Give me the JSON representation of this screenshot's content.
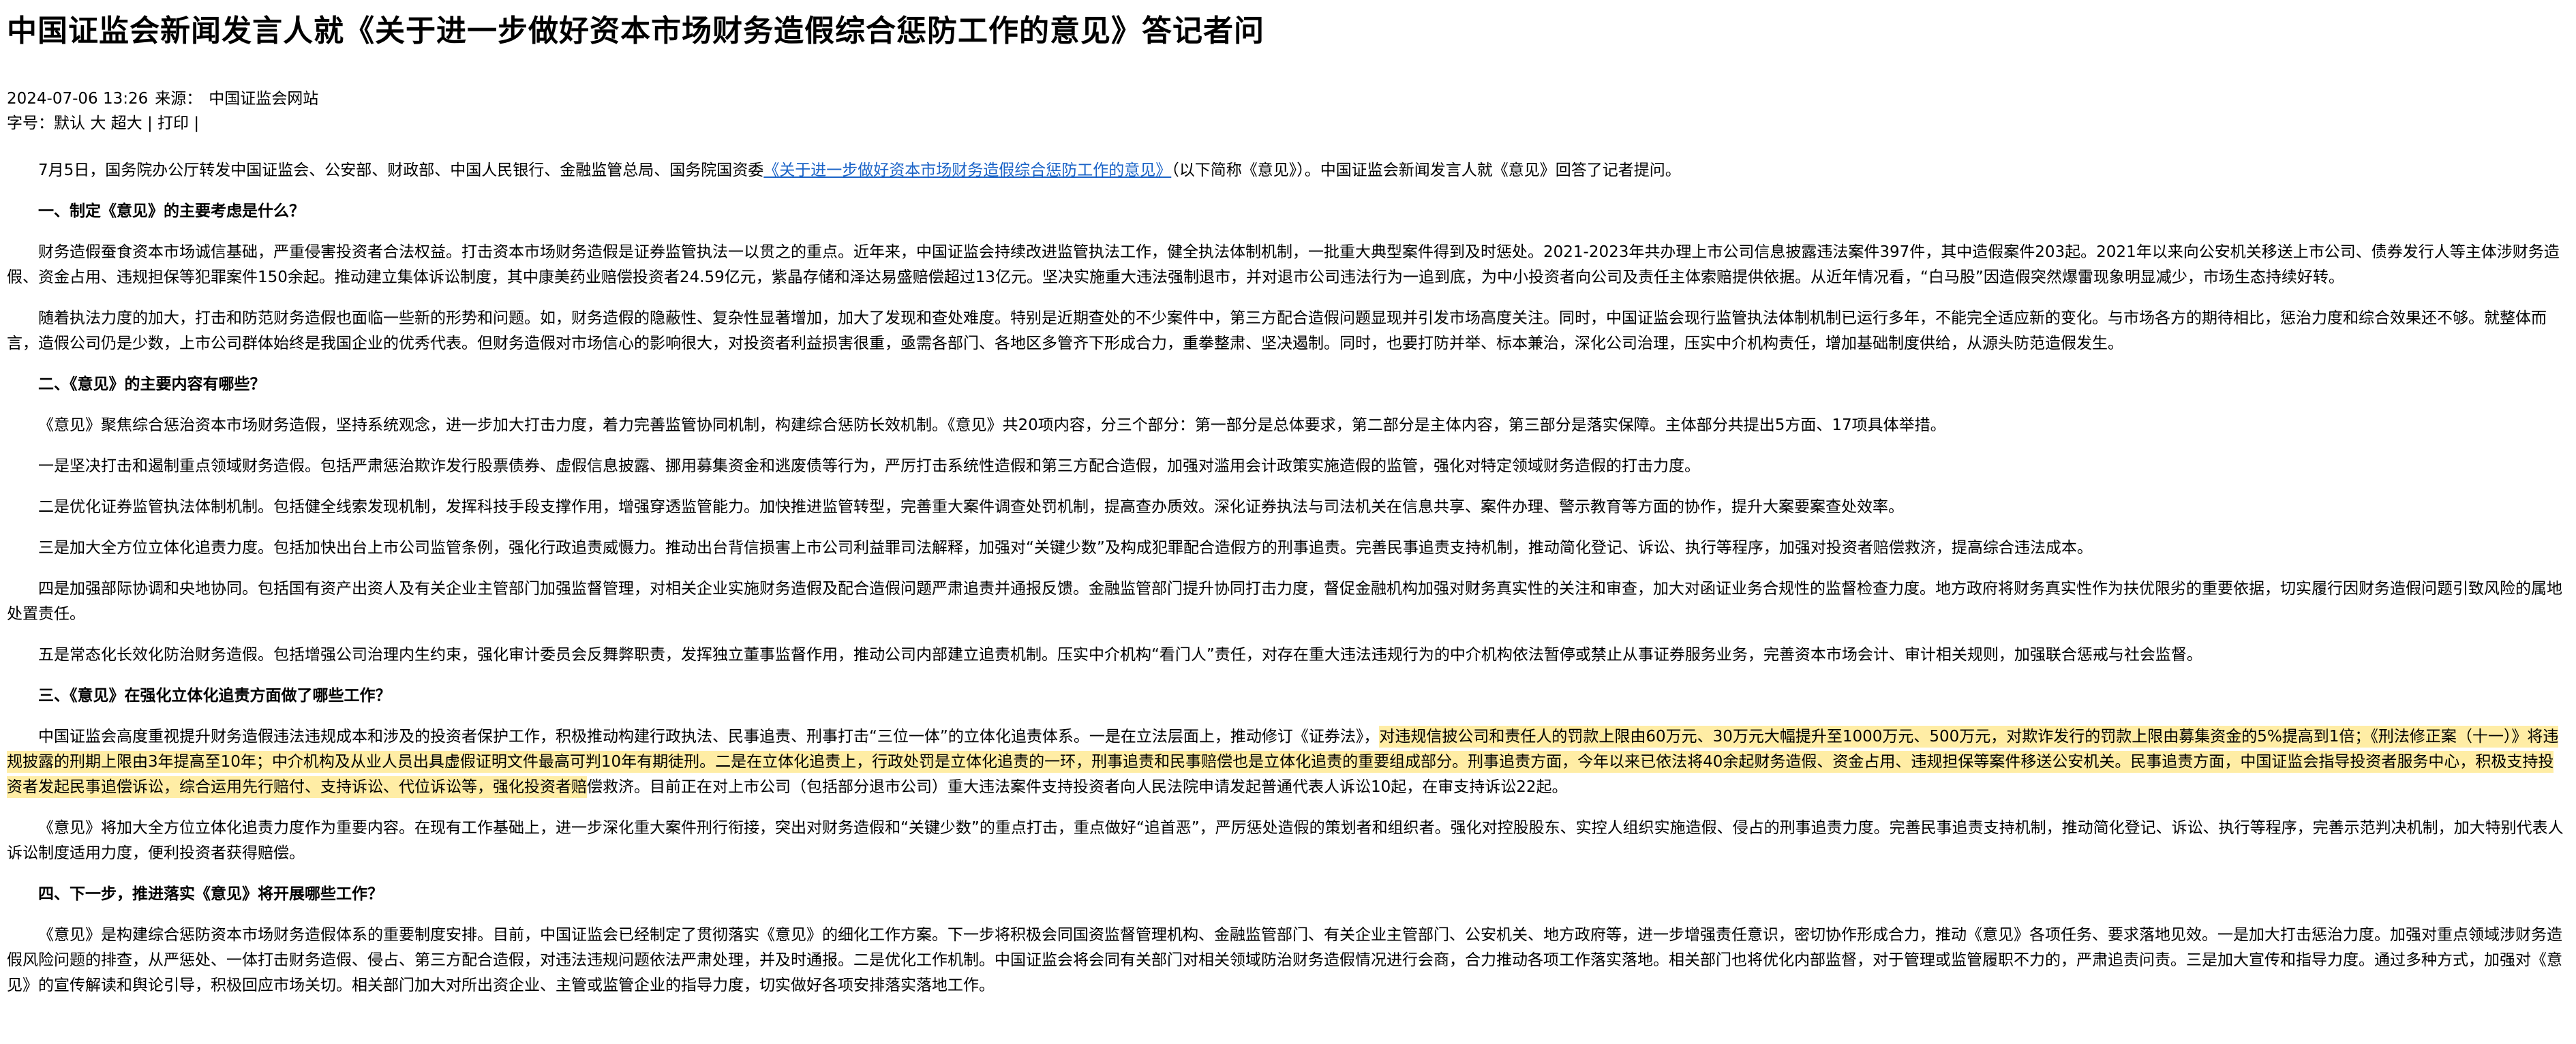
{
  "article": {
    "title": "中国证监会新闻发言人就《关于进一步做好资本市场财务造假综合惩防工作的意见》答记者问",
    "date": "2024-07-06 13:26",
    "source_label": "来源：",
    "source": "中国证监会网站",
    "font_size_label": "字号：",
    "font_default": "默认",
    "font_large": "大",
    "font_xlarge": "超大",
    "separator": "|",
    "print": "打印",
    "trailing_separator": "|"
  },
  "body": {
    "p1_a": "7月5日，国务院办公厅转发中国证监会、公安部、财政部、中国人民银行、金融监管总局、国务院国资委",
    "p1_link": "《关于进一步做好资本市场财务造假综合惩防工作的意见》",
    "p1_b": "（以下简称《意见》）。中国证监会新闻发言人就《意见》回答了记者提问。",
    "h1": "一、制定《意见》的主要考虑是什么？",
    "p2": "财务造假蚕食资本市场诚信基础，严重侵害投资者合法权益。打击资本市场财务造假是证券监管执法一以贯之的重点。近年来，中国证监会持续改进监管执法工作，健全执法体制机制，一批重大典型案件得到及时惩处。2021-2023年共办理上市公司信息披露违法案件397件，其中造假案件203起。2021年以来向公安机关移送上市公司、债券发行人等主体涉财务造假、资金占用、违规担保等犯罪案件150余起。推动建立集体诉讼制度，其中康美药业赔偿投资者24.59亿元，紫晶存储和泽达易盛赔偿超过13亿元。坚决实施重大违法强制退市，并对退市公司违法行为一追到底，为中小投资者向公司及责任主体索赔提供依据。从近年情况看，“白马股”因造假突然爆雷现象明显减少，市场生态持续好转。",
    "p3": "随着执法力度的加大，打击和防范财务造假也面临一些新的形势和问题。如，财务造假的隐蔽性、复杂性显著增加，加大了发现和查处难度。特别是近期查处的不少案件中，第三方配合造假问题显现并引发市场高度关注。同时，中国证监会现行监管执法体制机制已运行多年，不能完全适应新的变化。与市场各方的期待相比，惩治力度和综合效果还不够。就整体而言，造假公司仍是少数，上市公司群体始终是我国企业的优秀代表。但财务造假对市场信心的影响很大，对投资者利益损害很重，亟需各部门、各地区多管齐下形成合力，重拳整肃、坚决遏制。同时，也要打防并举、标本兼治，深化公司治理，压实中介机构责任，增加基础制度供给，从源头防范造假发生。",
    "h2": "二、《意见》的主要内容有哪些？",
    "p4": "《意见》聚焦综合惩治资本市场财务造假，坚持系统观念，进一步加大打击力度，着力完善监管协同机制，构建综合惩防长效机制。《意见》共20项内容，分三个部分：第一部分是总体要求，第二部分是主体内容，第三部分是落实保障。主体部分共提出5方面、17项具体举措。",
    "p5": "一是坚决打击和遏制重点领域财务造假。包括严肃惩治欺诈发行股票债券、虚假信息披露、挪用募集资金和逃废债等行为，严厉打击系统性造假和第三方配合造假，加强对滥用会计政策实施造假的监管，强化对特定领域财务造假的打击力度。",
    "p6": "二是优化证券监管执法体制机制。包括健全线索发现机制，发挥科技手段支撑作用，增强穿透监管能力。加快推进监管转型，完善重大案件调查处罚机制，提高查办质效。深化证券执法与司法机关在信息共享、案件办理、警示教育等方面的协作，提升大案要案查处效率。",
    "p7": "三是加大全方位立体化追责力度。包括加快出台上市公司监管条例，强化行政追责威慑力。推动出台背信损害上市公司利益罪司法解释，加强对“关键少数”及构成犯罪配合造假方的刑事追责。完善民事追责支持机制，推动简化登记、诉讼、执行等程序，加强对投资者赔偿救济，提高综合违法成本。",
    "p8": "四是加强部际协调和央地协同。包括国有资产出资人及有关企业主管部门加强监督管理，对相关企业实施财务造假及配合造假问题严肃追责并通报反馈。金融监管部门提升协同打击力度，督促金融机构加强对财务真实性的关注和审查，加大对函证业务合规性的监督检查力度。地方政府将财务真实性作为扶优限劣的重要依据，切实履行因财务造假问题引致风险的属地处置责任。",
    "p9": "五是常态化长效化防治财务造假。包括增强公司治理内生约束，强化审计委员会反舞弊职责，发挥独立董事监督作用，推动公司内部建立追责机制。压实中介机构“看门人”责任，对存在重大违法违规行为的中介机构依法暂停或禁止从事证券服务业务，完善资本市场会计、审计相关规则，加强联合惩戒与社会监督。",
    "h3": "三、《意见》在强化立体化追责方面做了哪些工作？",
    "p10_a": "中国证监会高度重视提升财务造假违法违规成本和涉及的投资者保护工作，积极推动构建行政执法、民事追责、刑事打击“三位一体”的立体化追责体系。一是在立法层面上，推动修订《证券法》，",
    "p10_b": "对违规信披公司和责任人的罚款上限由60万元、30万元大幅提升至1000万元、500万元，对欺诈发行的罚款上限由募集资金的5%提高到1倍；《刑法修正案（十一）》将违规披露的刑期上限由3年提高至10年；中介机构及从业人员出具虚假证明文件最高可判10年有期徒刑。二是在立体化追责上，行政处罚是立体化追责的一环，刑事追责和民事赔偿也是立体化追责的重要组成部分。刑事追责方面，今年以来已依法将40余起财务造假、资金占用、违规担保等案件移送公安机关。民事追责方面，中国证监会指导投资者服务中心，积极支持投资者发起民事追偿诉讼，综合运用先行赔付、支持诉讼、代位诉讼等，强化投资者赔",
    "p10_c": "偿救济。目前正在对上市公司（包括部分退市公司）重大违法案件支持投资者向人民法院申请发起普通代表人诉讼10起，在审支持诉讼22起。",
    "p11": "《意见》将加大全方位立体化追责力度作为重要内容。在现有工作基础上，进一步深化重大案件刑行衔接，突出对财务造假和“关键少数”的重点打击，重点做好“追首恶”，严厉惩处造假的策划者和组织者。强化对控股股东、实控人组织实施造假、侵占的刑事追责力度。完善民事追责支持机制，推动简化登记、诉讼、执行等程序，完善示范判决机制，加大特别代表人诉讼制度适用力度，便利投资者获得赔偿。",
    "h4": "四、下一步，推进落实《意见》将开展哪些工作？",
    "p12": "《意见》是构建综合惩防资本市场财务造假体系的重要制度安排。目前，中国证监会已经制定了贯彻落实《意见》的细化工作方案。下一步将积极会同国资监督管理机构、金融监管部门、有关企业主管部门、公安机关、地方政府等，进一步增强责任意识，密切协作形成合力，推动《意见》各项任务、要求落地见效。一是加大打击惩治力度。加强对重点领域涉财务造假风险问题的排查，从严惩处、一体打击财务造假、侵占、第三方配合造假，对违法违规问题依法严肃处理，并及时通报。二是优化工作机制。中国证监会将会同有关部门对相关领域防治财务造假情况进行会商，合力推动各项工作落实落地。相关部门也将优化内部监督，对于管理或监管履职不力的，严肃追责问责。三是加大宣传和指导力度。通过多种方式，加强对《意见》的宣传解读和舆论引导，积极回应市场关切。相关部门加大对所出资企业、主管或监管企业的指导力度，切实做好各项安排落实落地工作。"
  },
  "colors": {
    "link": "#1a63c7",
    "highlight": "#ffe26e"
  }
}
